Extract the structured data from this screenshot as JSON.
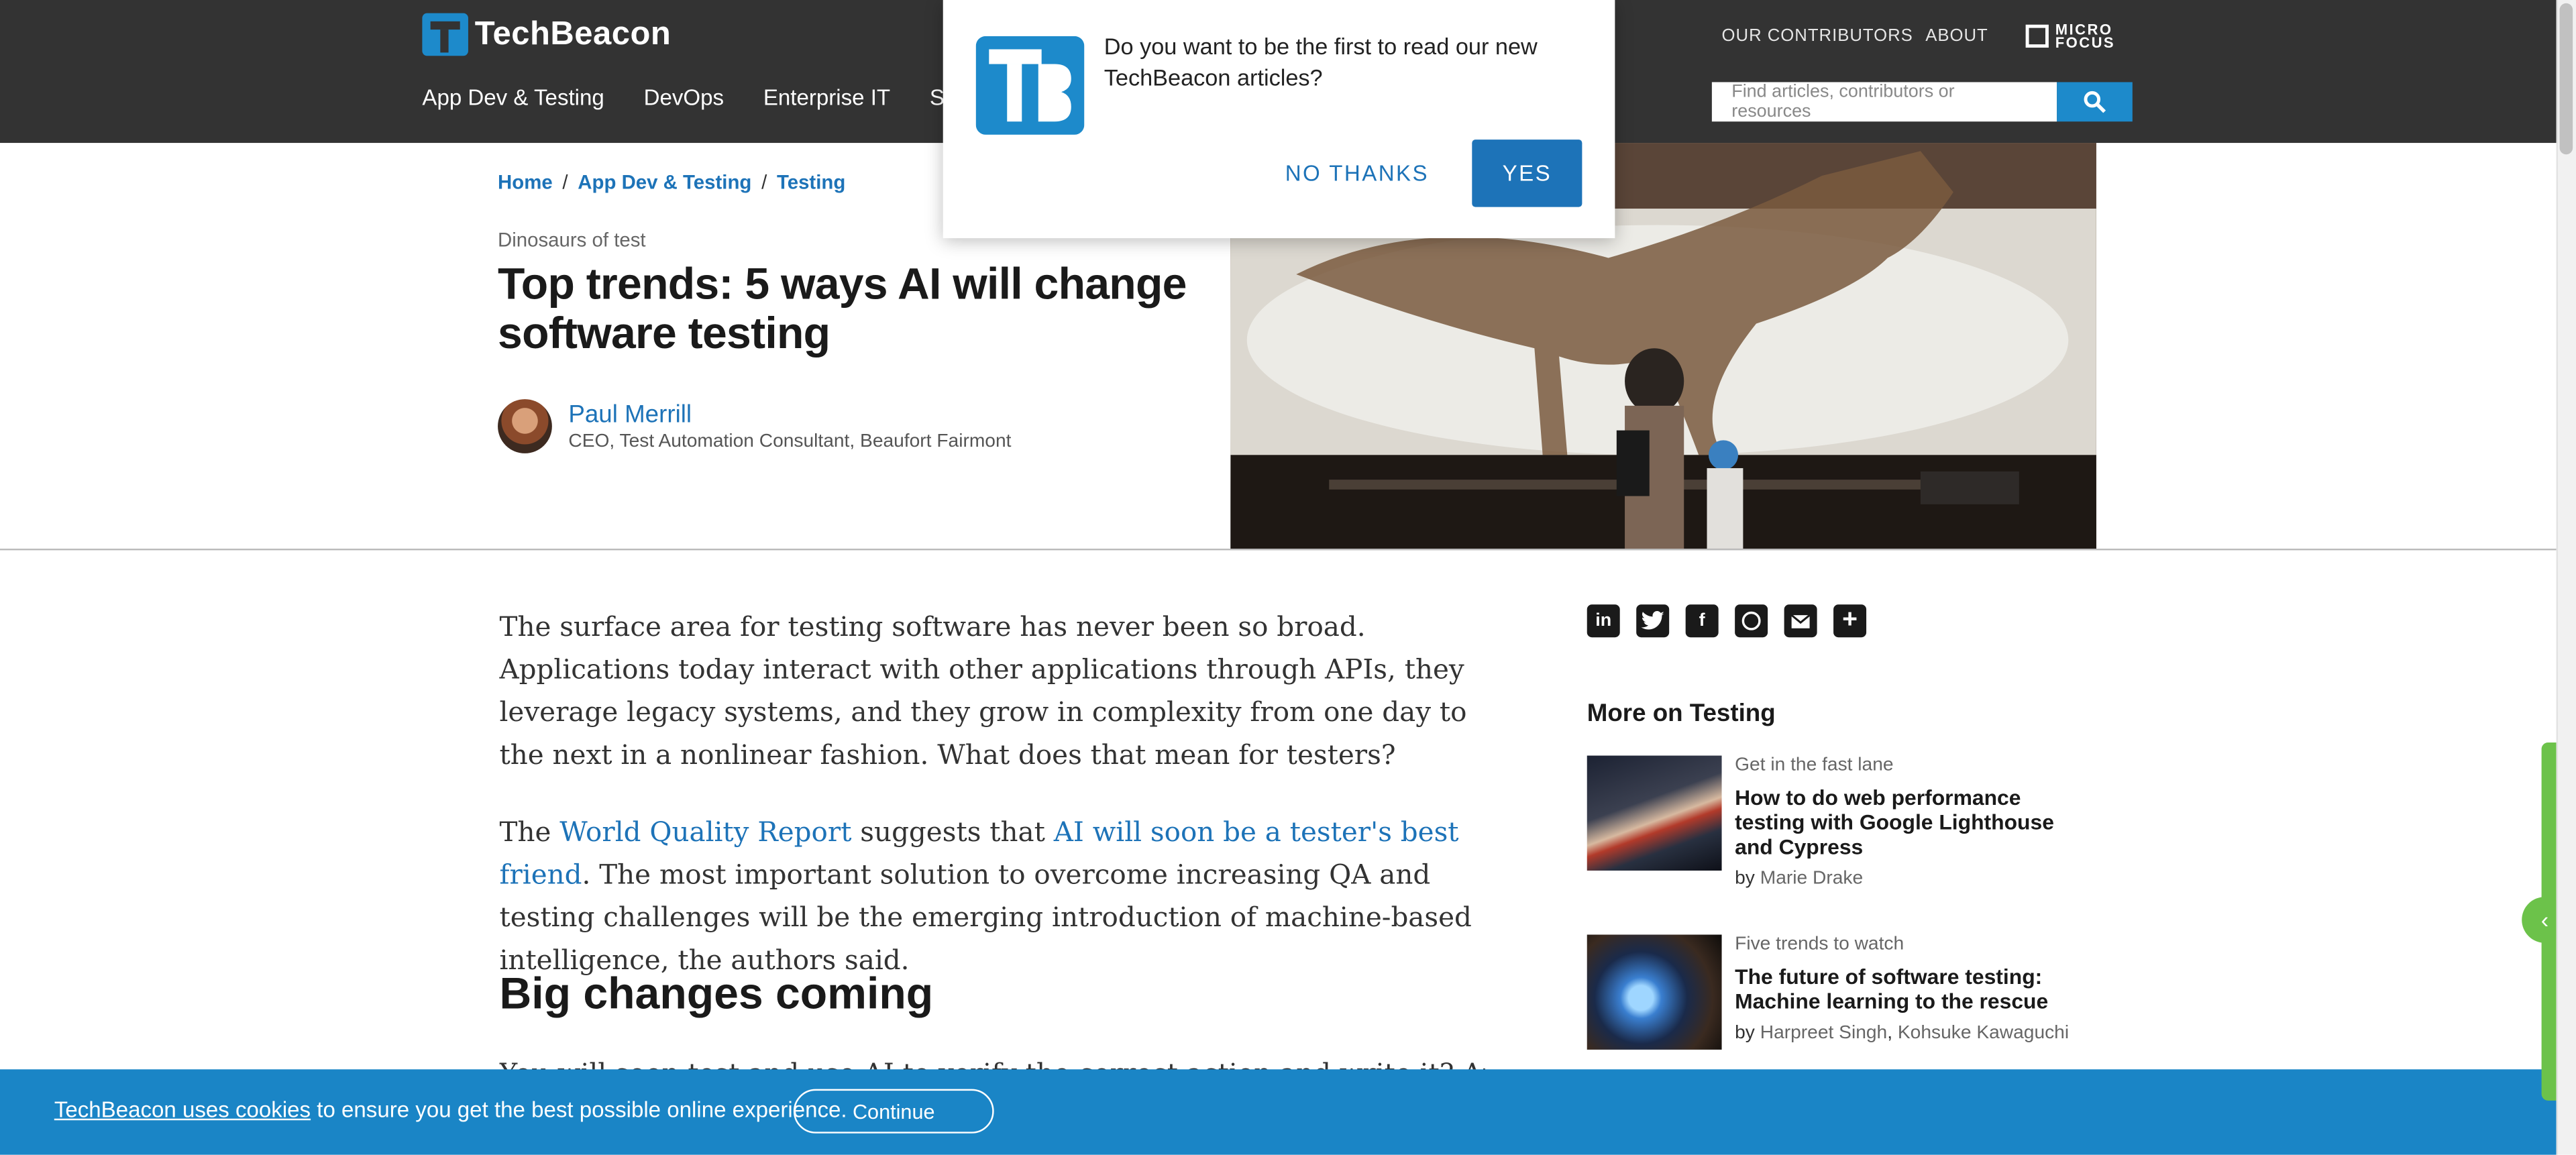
{
  "header": {
    "logo_text": "TechBeacon",
    "top_links": [
      "OUR CONTRIBUTORS",
      "ABOUT"
    ],
    "brand_partner": [
      "MICRO",
      "FOCUS"
    ],
    "nav": [
      "App Dev & Testing",
      "DevOps",
      "Enterprise IT",
      "Sec"
    ],
    "search_placeholder": "Find articles, contributors or resources"
  },
  "popup": {
    "message": "Do you want to be the first to read our new TechBeacon articles?",
    "no_label": "NO THANKS",
    "yes_label": "YES"
  },
  "breadcrumb": [
    "Home",
    "App Dev & Testing",
    "Testing"
  ],
  "article": {
    "kicker": "Dinosaurs of test",
    "title": "Top trends: 5 ways AI will change software testing",
    "author_name": "Paul Merrill",
    "author_role": "CEO, Test Automation Consultant, Beaufort Fairmont",
    "p1": "The surface area for testing software has never been so broad. Applications today interact with other applications through APIs, they leverage legacy systems, and they grow in complexity from one day to the next in a nonlinear fashion. What does that mean for testers?",
    "p2_pre": "The ",
    "p2_link1": "World Quality Report",
    "p2_mid": " suggests that ",
    "p2_link2": "AI will soon be a tester's best friend",
    "p2_post": ". The most important solution to overcome increasing QA and testing challenges will be the emerging introduction of machine-based intelligence, the authors said.",
    "h2": "Big changes coming",
    "cut_text": "You will soon test and use AI to verify the correct action and write it? And"
  },
  "share_icons": [
    "linkedin-icon",
    "twitter-icon",
    "facebook-icon",
    "whatsapp-icon",
    "email-icon",
    "plus-icon"
  ],
  "sidebar": {
    "title": "More on Testing",
    "cards": [
      {
        "kicker": "Get in the fast lane",
        "headline": "How to do web performance testing with Google Lighthouse and Cypress",
        "by": "by",
        "authors": "Marie Drake"
      },
      {
        "kicker": "Five trends to watch",
        "headline": "The future of software testing: Machine learning to the rescue",
        "by": "by",
        "author1": "Harpreet Singh",
        "sep": ",",
        "author2": "Kohsuke Kawaguchi"
      }
    ]
  },
  "cookie": {
    "link": "TechBeacon uses cookies",
    "text": " to ensure you get the best possible online experience.",
    "button": "Continue"
  },
  "colors": {
    "accent": "#1d73b8",
    "header_bg": "#333333",
    "cookie_bg": "#1a85c6",
    "side_tab": "#6cc24a"
  }
}
